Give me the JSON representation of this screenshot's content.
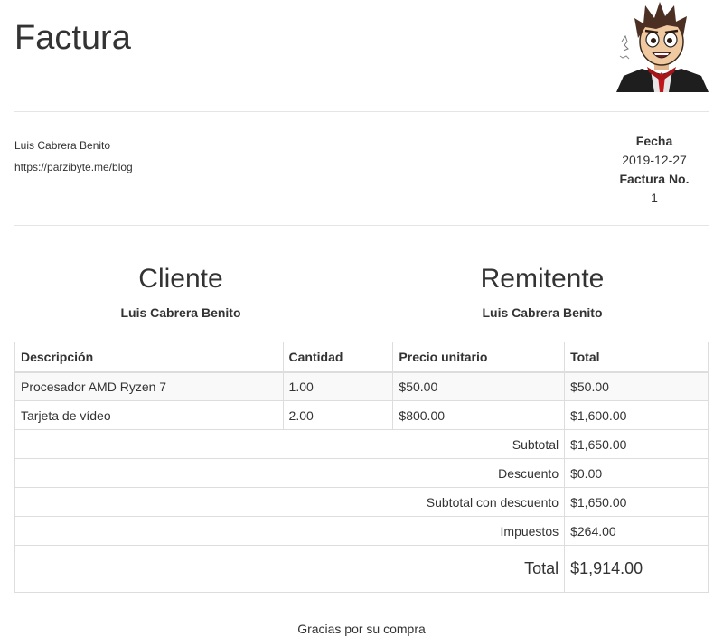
{
  "header": {
    "title": "Factura"
  },
  "company": {
    "name": "Luis Cabrera Benito",
    "website": "https://parzibyte.me/blog"
  },
  "meta": {
    "date_label": "Fecha",
    "date": "2019-12-27",
    "invoice_label": "Factura No.",
    "invoice_number": "1"
  },
  "client": {
    "heading": "Cliente",
    "name": "Luis Cabrera Benito"
  },
  "sender": {
    "heading": "Remitente",
    "name": "Luis Cabrera Benito"
  },
  "table": {
    "headers": [
      "Descripción",
      "Cantidad",
      "Precio unitario",
      "Total"
    ],
    "rows": [
      {
        "description": "Procesador AMD Ryzen 7",
        "quantity": "1.00",
        "unit_price": "$50.00",
        "total": "$50.00"
      },
      {
        "description": "Tarjeta de vídeo",
        "quantity": "2.00",
        "unit_price": "$800.00",
        "total": "$1,600.00"
      }
    ],
    "summary": [
      {
        "label": "Subtotal",
        "value": "$1,650.00"
      },
      {
        "label": "Descuento",
        "value": "$0.00"
      },
      {
        "label": "Subtotal con descuento",
        "value": "$1,650.00"
      },
      {
        "label": "Impuestos",
        "value": "$264.00"
      }
    ],
    "grand_total": {
      "label": "Total",
      "value": "$1,914.00"
    }
  },
  "footer": {
    "thanks": "Gracias por su compra"
  }
}
